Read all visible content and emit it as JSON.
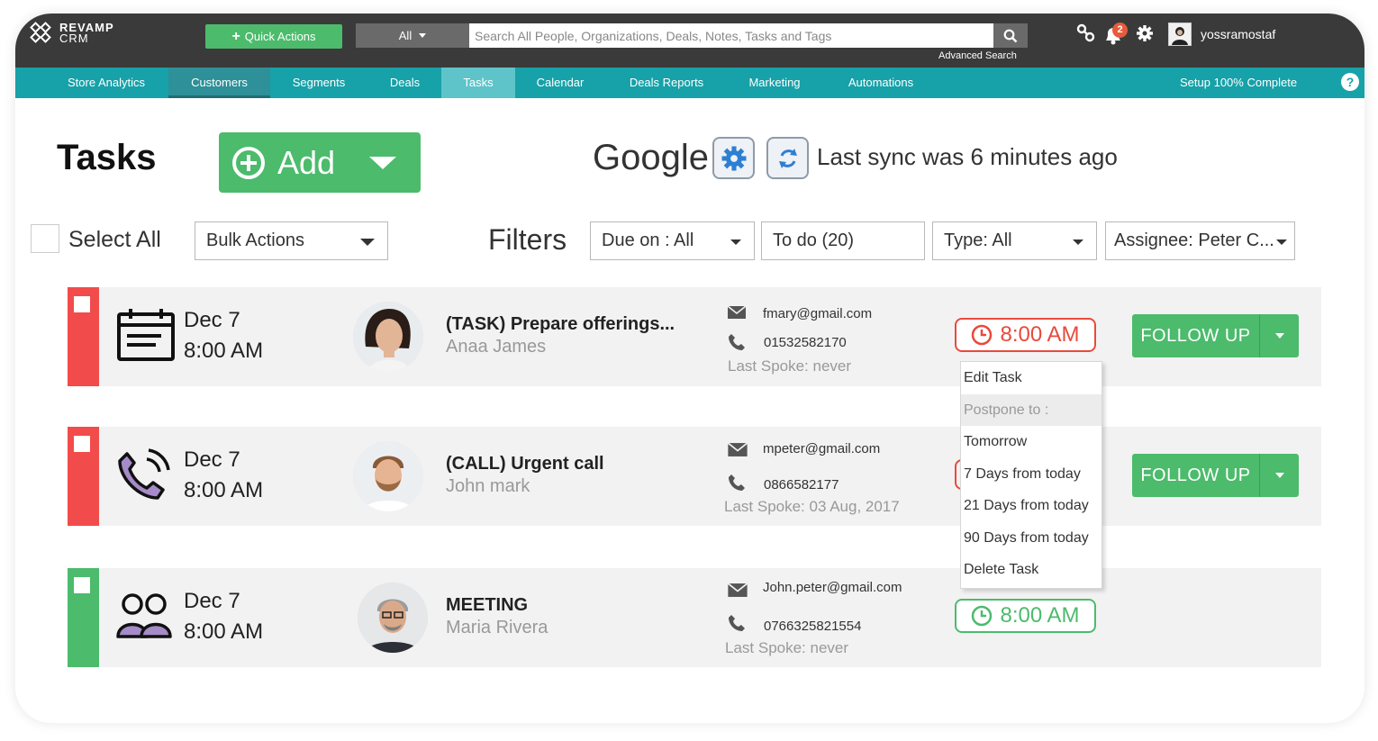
{
  "app": {
    "logo_line1": "REVAMP",
    "logo_line2": "CRM"
  },
  "topbar": {
    "quick_actions_label": "Quick Actions",
    "search_category": "All",
    "search_placeholder": "Search All People, Organizations, Deals, Notes, Tasks and Tags",
    "advanced_search": "Advanced Search",
    "notification_count": "2",
    "username": "yossramostaf"
  },
  "nav": {
    "items": [
      {
        "label": "Store Analytics"
      },
      {
        "label": "Customers"
      },
      {
        "label": "Segments"
      },
      {
        "label": "Deals"
      },
      {
        "label": "Tasks"
      },
      {
        "label": "Calendar"
      },
      {
        "label": "Deals Reports"
      },
      {
        "label": "Marketing"
      },
      {
        "label": "Automations"
      }
    ],
    "setup": "Setup 100% Complete",
    "help": "?"
  },
  "header": {
    "title": "Tasks",
    "add_label": "Add",
    "google_label": "Google",
    "sync_text": "Last sync was 6 minutes ago"
  },
  "filters": {
    "select_all": "Select All",
    "bulk_actions": "Bulk Actions",
    "label": "Filters",
    "due_on": "Due on : All",
    "todo": "To do (20)",
    "type": "Type: All",
    "assignee": "Assignee: Peter C..."
  },
  "tasks": [
    {
      "date": "Dec 7",
      "time": "8:00 AM",
      "title": "(TASK) Prepare offerings...",
      "person": "Anaa James",
      "email": "fmary@gmail.com",
      "phone": "01532582170",
      "last_spoke": "Last Spoke: never",
      "pill_time": "8:00 AM",
      "follow_label": "FOLLOW UP"
    },
    {
      "date": "Dec 7",
      "time": "8:00 AM",
      "title": "(CALL) Urgent call",
      "person": "John mark",
      "email": "mpeter@gmail.com",
      "phone": "0866582177",
      "last_spoke": "Last Spoke: 03 Aug, 2017",
      "follow_label": "FOLLOW UP"
    },
    {
      "date": "Dec 7",
      "time": "8:00 AM",
      "title": "MEETING",
      "person": "Maria Rivera",
      "email": "John.peter@gmail.com",
      "phone": "0766325821554",
      "last_spoke": "Last Spoke: never",
      "pill_time": "8:00 AM"
    }
  ],
  "menu": {
    "items": [
      "Edit Task",
      "Postpone to :",
      "Tomorrow",
      "7 Days from today",
      "21 Days from today",
      "90 Days from today",
      "Delete Task"
    ]
  },
  "colors": {
    "topbar": "#3a3a3a",
    "nav": "#17a1a8",
    "green": "#4cbb6c",
    "red": "#f24b4b",
    "pill_red": "#e84a3c"
  }
}
